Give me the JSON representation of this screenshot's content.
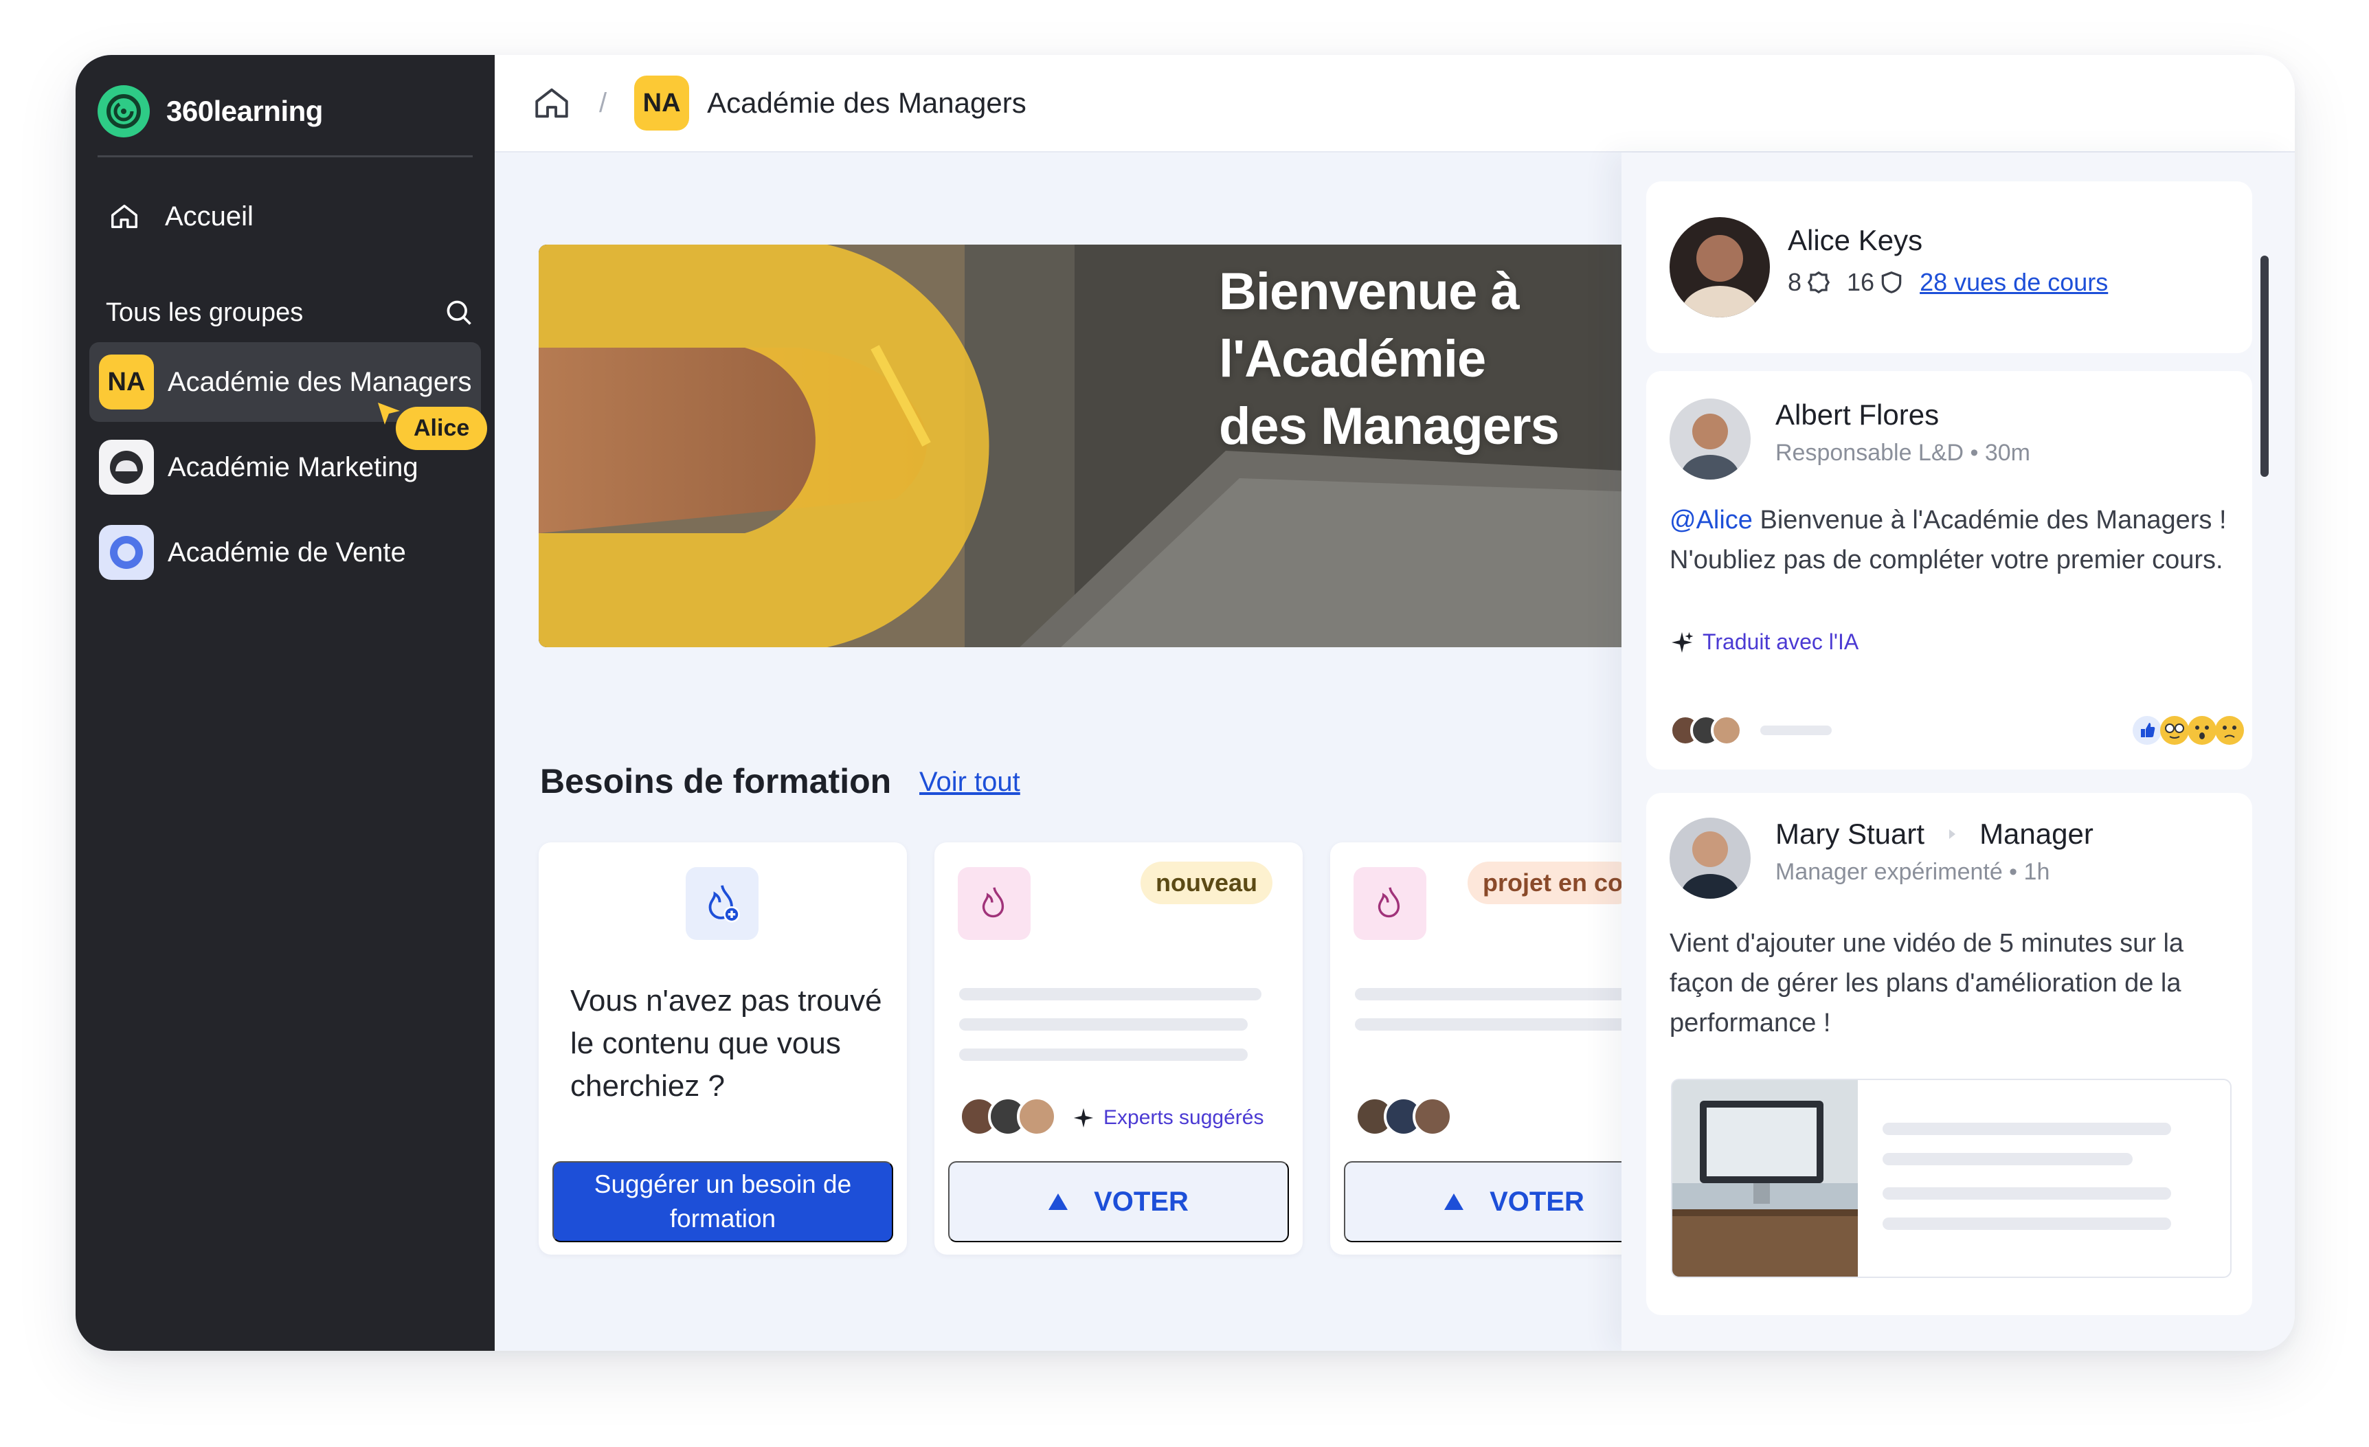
{
  "brand": {
    "name": "360learning",
    "color": "#2ecb86"
  },
  "sidebar": {
    "home_label": "Accueil",
    "groups_title": "Tous les groupes",
    "groups": [
      {
        "tag": "NA",
        "label": "Académie des Managers",
        "active": true
      },
      {
        "tag": "",
        "label": "Académie Marketing",
        "active": false
      },
      {
        "tag": "",
        "label": "Académie de Vente",
        "active": false
      }
    ],
    "cursor_name": "Alice"
  },
  "breadcrumb": {
    "separator": "/",
    "tag": "NA",
    "title": "Académie des Managers"
  },
  "hero": {
    "title": "Bienvenue à l'Académie des Managers"
  },
  "needs": {
    "title": "Besoins de formation",
    "see_all": "Voir tout",
    "suggest_card": {
      "text": "Vous n'avez pas trouvé le contenu que vous cherchiez ?",
      "button": "Suggérer un besoin de formation"
    },
    "cards": [
      {
        "badge": "nouveau",
        "experts_label": "Experts suggérés",
        "vote_label": "VOTER"
      },
      {
        "badge": "projet en co",
        "vote_label": "VOTER"
      }
    ]
  },
  "panel": {
    "profile": {
      "name": "Alice Keys",
      "stat1": "8",
      "stat2": "16",
      "views_link": "28 vues de cours"
    },
    "post1": {
      "author": "Albert Flores",
      "meta": "Responsable L&D • 30m",
      "mention": "@Alice",
      "text": " Bienvenue à l'Académie des Managers ! N'oubliez pas de compléter votre premier cours.",
      "translated": "Traduit avec l'IA"
    },
    "post2": {
      "author": "Mary Stuart",
      "target": "Manager",
      "meta": "Manager expérimenté • 1h",
      "text": "Vient d'ajouter une vidéo de 5 minutes sur la façon de gérer les plans d'amélioration de la performance !"
    }
  },
  "colors": {
    "accent": "#1d4fd8",
    "yellow": "#fcc935",
    "sidebar": "#24252a",
    "ai": "#4b3ad3"
  }
}
